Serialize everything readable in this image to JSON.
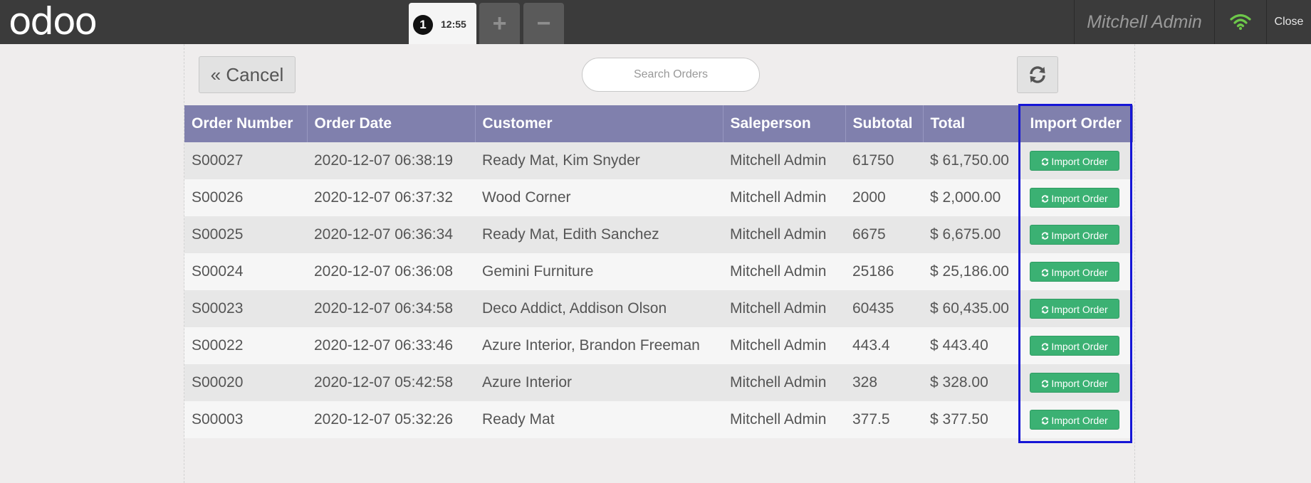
{
  "topbar": {
    "logo_text": "odoo",
    "order_tab": {
      "number": "1",
      "time": "12:55"
    },
    "add_label": "+",
    "remove_label": "−",
    "user_name": "Mitchell Admin",
    "wifi_icon": "wifi-icon",
    "wifi_color": "#6ec84a",
    "close_label": "Close"
  },
  "toolbar": {
    "cancel_label": "Cancel",
    "search_placeholder": "Search Orders",
    "refresh_icon": "refresh-icon"
  },
  "table": {
    "header_color": "#8080ad",
    "columns": [
      "Order Number",
      "Order Date",
      "Customer",
      "Saleperson",
      "Subtotal",
      "Total",
      "Import Order"
    ],
    "import_button_label": "Import Order",
    "import_button_color": "#3bb173",
    "rows": [
      {
        "order_number": "S00027",
        "order_date": "2020-12-07 06:38:19",
        "customer": "Ready Mat, Kim Snyder",
        "saleperson": "Mitchell Admin",
        "subtotal": "61750",
        "total": "$ 61,750.00"
      },
      {
        "order_number": "S00026",
        "order_date": "2020-12-07 06:37:32",
        "customer": "Wood Corner",
        "saleperson": "Mitchell Admin",
        "subtotal": "2000",
        "total": "$ 2,000.00"
      },
      {
        "order_number": "S00025",
        "order_date": "2020-12-07 06:36:34",
        "customer": "Ready Mat, Edith Sanchez",
        "saleperson": "Mitchell Admin",
        "subtotal": "6675",
        "total": "$ 6,675.00"
      },
      {
        "order_number": "S00024",
        "order_date": "2020-12-07 06:36:08",
        "customer": "Gemini Furniture",
        "saleperson": "Mitchell Admin",
        "subtotal": "25186",
        "total": "$ 25,186.00"
      },
      {
        "order_number": "S00023",
        "order_date": "2020-12-07 06:34:58",
        "customer": "Deco Addict, Addison Olson",
        "saleperson": "Mitchell Admin",
        "subtotal": "60435",
        "total": "$ 60,435.00"
      },
      {
        "order_number": "S00022",
        "order_date": "2020-12-07 06:33:46",
        "customer": "Azure Interior, Brandon Freeman",
        "saleperson": "Mitchell Admin",
        "subtotal": "443.4",
        "total": "$ 443.40"
      },
      {
        "order_number": "S00020",
        "order_date": "2020-12-07 05:42:58",
        "customer": "Azure Interior",
        "saleperson": "Mitchell Admin",
        "subtotal": "328",
        "total": "$ 328.00"
      },
      {
        "order_number": "S00003",
        "order_date": "2020-12-07 05:32:26",
        "customer": "Ready Mat",
        "saleperson": "Mitchell Admin",
        "subtotal": "377.5",
        "total": "$ 377.50"
      }
    ]
  },
  "highlight_color": "#1515d6"
}
